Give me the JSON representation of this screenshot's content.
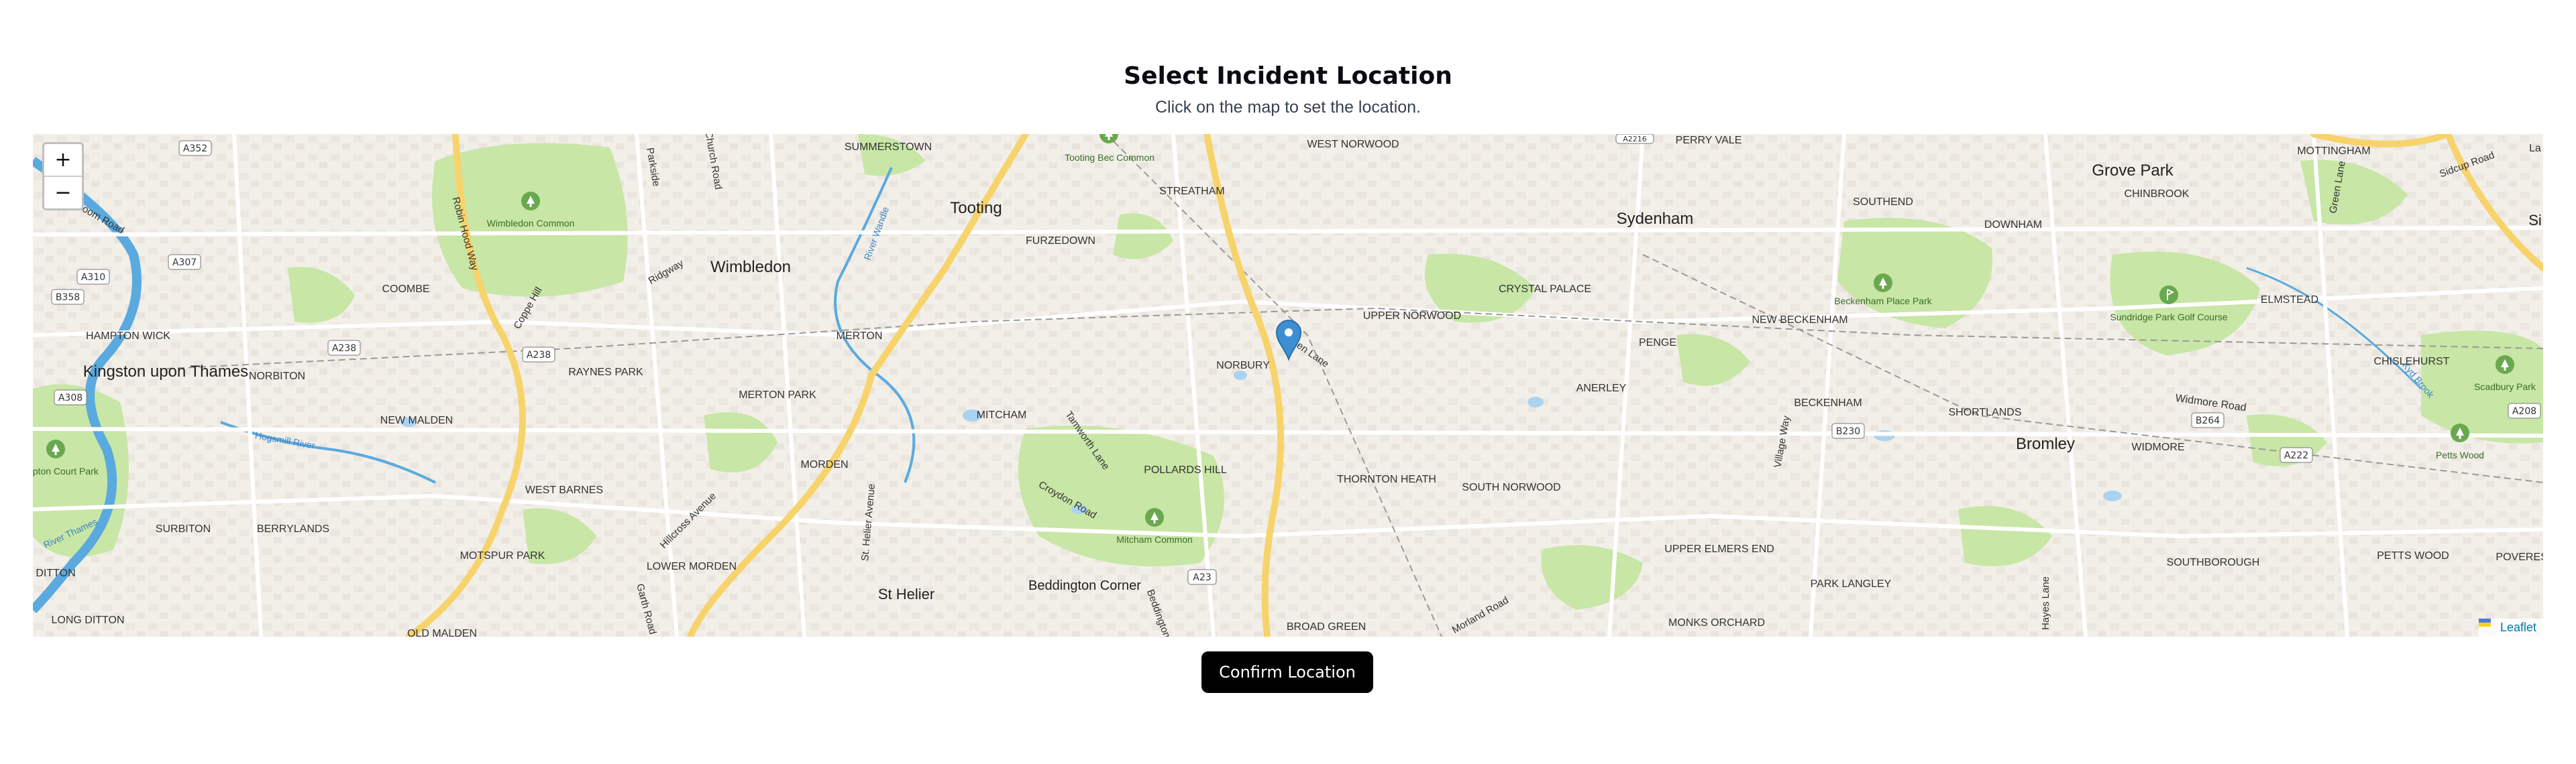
{
  "header": {
    "title": "Select Incident Location",
    "subtitle": "Click on the map to set the location."
  },
  "map": {
    "zoom_in": "+",
    "zoom_out": "−",
    "attribution": "Leaflet",
    "colors": {
      "land": "#f2efe9",
      "park": "#c8e6a5",
      "water": "#a9d3f0",
      "road_major": "#f7d36b",
      "road": "#ffffff",
      "river": "#5aaadf",
      "marker": "#3d8fd1"
    },
    "places": {
      "summerstown": "SUMMERSTOWN",
      "tooting_bec": "Tooting Bec Common",
      "west_norwood": "WEST NORWOOD",
      "perry_vale": "PERRY VALE",
      "grove_park": "Grove Park",
      "mottingham": "MOTTINGHAM",
      "sidcup_road": "Sidcup Road",
      "streatham": "STREATHAM",
      "tooting": "Tooting",
      "wimbledon_common": "Wimbledon Common",
      "furzedown": "FURZEDOWN",
      "sydenham": "Sydenham",
      "southend": "SOUTHEND",
      "downham": "DOWNHAM",
      "chinbrook": "CHINBROOK",
      "green_lane_north": "Green Lane",
      "wimbledon": "Wimbledon",
      "coombe": "COOMBE",
      "crystal_palace": "CRYSTAL PALACE",
      "upper_norwood": "UPPER NORWOOD",
      "beckenham_place_park": "Beckenham Place Park",
      "sundridge_park": "Sundridge Park Golf Course",
      "elmstead": "ELMSTEAD",
      "new_beckenham": "NEW BECKENHAM",
      "hampton_wick": "HAMPTON WICK",
      "merton": "MERTON",
      "norbury": "NORBURY",
      "green_lane": "Green Lane",
      "penge": "PENGE",
      "chislehurst": "CHISLEHURST",
      "kingston": "Kingston upon Thames",
      "norbiton": "NORBITON",
      "raynes_park": "RAYNES PARK",
      "merton_park": "MERTON PARK",
      "mitcham": "MITCHAM",
      "anerley": "ANERLEY",
      "beckenham": "BECKENHAM",
      "shortlands": "SHORTLANDS",
      "widmore_road": "Widmore Road",
      "new_malden": "NEW MALDEN",
      "tamworth_lane": "Tamworth Lane",
      "pollards_hill": "POLLARDS HILL",
      "bromley": "Bromley",
      "widmore": "WIDMORE",
      "scadbury": "Scadbury Park",
      "petts_wood_park": "Petts Wood",
      "morden": "MORDEN",
      "thornton_heath": "THORNTON HEATH",
      "south_norwood": "SOUTH NORWOOD",
      "hampton_court": "Hampton Court Park",
      "west_barnes": "WEST BARNES",
      "surbiton": "SURBITON",
      "berrylands": "BERRYLANDS",
      "mitcham_common": "Mitcham Common",
      "upper_elmers_end": "UPPER ELMERS END",
      "motspur_park": "MOTSPUR PARK",
      "lower_morden": "LOWER MORDEN",
      "southborough": "SOUTHBOROUGH",
      "petts_wood": "PETTS WOOD",
      "ditton": "DITTON",
      "st_helier": "St Helier",
      "beddington": "Beddington Corner",
      "park_langley": "PARK LANGLEY",
      "long_ditton": "LONG DITTON",
      "old_malden": "OLD MALDEN",
      "broad_green": "BROAD GREEN",
      "monks_orchard": "MONKS ORCHARD",
      "robin_hood_way": "Robin Hood Way",
      "coppe_hill": "Coppe Hill",
      "ridgway": "Ridgway",
      "parkside": "Parkside",
      "church_road": "Church Road",
      "river_wandle": "River Wandle",
      "hogsmill": "Hogsmill River",
      "river_thames": "River Thames",
      "broom_road": "Broom Road",
      "hillcross": "Hillcross Avenue",
      "croydon_road": "Croydon Road",
      "st_helier_avenue": "St. Helier Avenue",
      "garth_road": "Garth Road",
      "village_way": "Village Way",
      "hayes_lane": "Hayes Lane",
      "kyd_brook": "Kyd Brook",
      "morland_road": "Morland Road",
      "beddington_lane": "Beddington Lane",
      "poverest": "POVEREST",
      "si": "Si",
      "la": "La"
    },
    "shields": {
      "a352": "A352",
      "a307": "A307",
      "a310": "A310",
      "b358": "B358",
      "a238_1": "A238",
      "a238_2": "A238",
      "a308": "A308",
      "a23": "A23",
      "b230": "B230",
      "b264": "B264",
      "a222": "A222",
      "a208": "A208",
      "a2216": "A2216"
    }
  },
  "confirm_button": {
    "label": "Confirm Location"
  }
}
